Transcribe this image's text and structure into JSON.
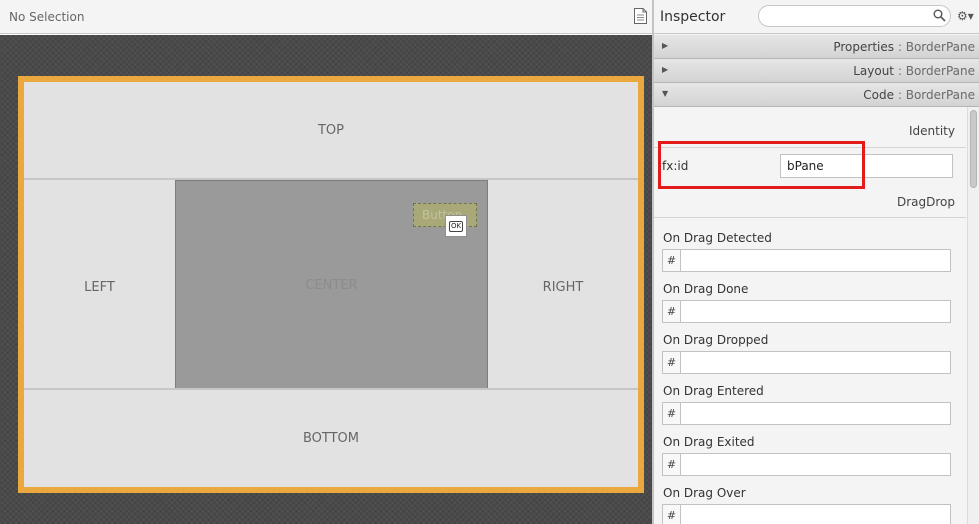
{
  "canvas": {
    "selection_label": "No Selection",
    "regions": {
      "top": "TOP",
      "left": "LEFT",
      "center": "CENTER",
      "right": "RIGHT",
      "bottom": "BOTTOM"
    },
    "ghost_button_label": "Button",
    "drop_tooltip_label": "OK"
  },
  "inspector": {
    "title": "Inspector",
    "search": {
      "value": "",
      "placeholder": ""
    },
    "sections": [
      {
        "label": "Properties",
        "separator": ":",
        "class_name": "BorderPane",
        "expanded": false
      },
      {
        "label": "Layout",
        "separator": ":",
        "class_name": "BorderPane",
        "expanded": false
      },
      {
        "label": "Code",
        "separator": ":",
        "class_name": "BorderPane",
        "expanded": true
      }
    ],
    "identity": {
      "heading": "Identity",
      "fxid_label": "fx:id",
      "fxid_value": "bPane"
    },
    "dragdrop": {
      "heading": "DragDrop",
      "events": [
        {
          "label": "On Drag Detected",
          "prefix": "#",
          "value": ""
        },
        {
          "label": "On Drag Done",
          "prefix": "#",
          "value": ""
        },
        {
          "label": "On Drag Dropped",
          "prefix": "#",
          "value": ""
        },
        {
          "label": "On Drag Entered",
          "prefix": "#",
          "value": ""
        },
        {
          "label": "On Drag Exited",
          "prefix": "#",
          "value": ""
        },
        {
          "label": "On Drag Over",
          "prefix": "#",
          "value": ""
        }
      ]
    }
  },
  "icons": {
    "document": "document-icon",
    "search": "search-icon",
    "settings": "gear-icon",
    "collapsed": "triangle-right-icon",
    "expanded": "triangle-down-icon"
  },
  "colors": {
    "selection_border": "#eaa83e",
    "highlight_box": "#e31b1b",
    "center_region": "#9a9a9a",
    "region_background": "#e2e2e2"
  }
}
